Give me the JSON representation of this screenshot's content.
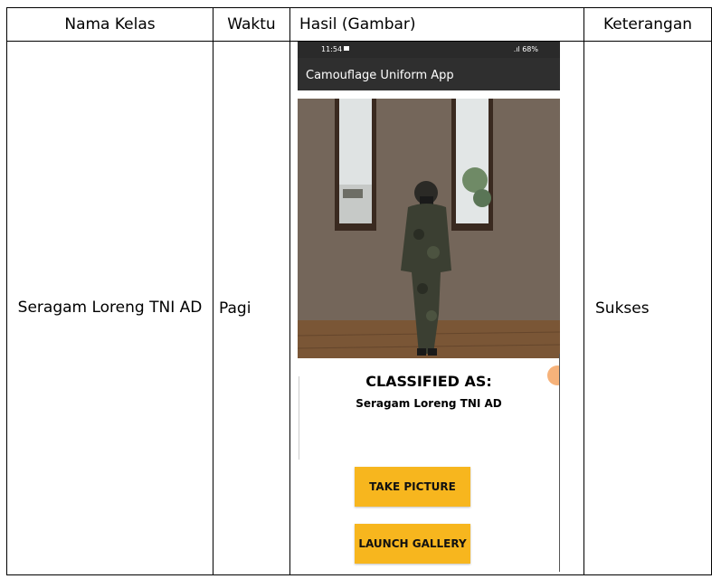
{
  "table": {
    "headers": [
      "Nama Kelas",
      "Waktu",
      "Hasil (Gambar)",
      "Keterangan"
    ],
    "row": {
      "class_name": "Seragam Loreng TNI AD",
      "time": "Pagi",
      "note": "Sukses"
    }
  },
  "phone": {
    "status_time": "11:54",
    "status_right": ".ıl 68%",
    "app_title": "Camouflage Uniform App",
    "classified_label": "CLASSIFIED AS:",
    "classified_result": "Seragam Loreng TNI AD",
    "take_picture_label": "TAKE PICTURE",
    "launch_gallery_label": "LAUNCH GALLERY",
    "accent_color": "#f7b61e",
    "appbar_color": "#2f2f2f"
  }
}
